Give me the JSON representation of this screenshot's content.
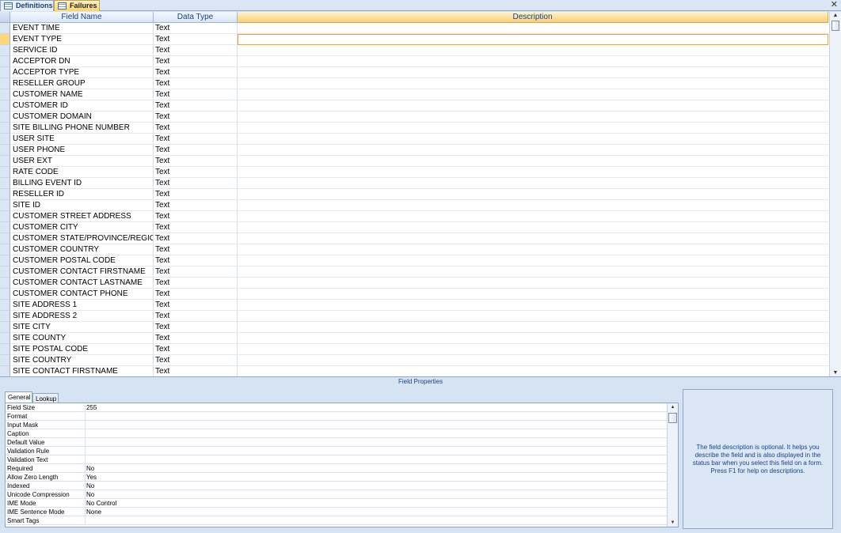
{
  "tabs": [
    {
      "label": "Definitions",
      "active": false
    },
    {
      "label": "Failures",
      "active": true
    }
  ],
  "close_glyph": "✕",
  "grid": {
    "columns": [
      "Field Name",
      "Data Type",
      "Description"
    ],
    "rows": [
      {
        "name": "EVENT TIME",
        "type": "Text"
      },
      {
        "name": "EVENT TYPE",
        "type": "Text"
      },
      {
        "name": "SERVICE ID",
        "type": "Text"
      },
      {
        "name": "ACCEPTOR DN",
        "type": "Text"
      },
      {
        "name": "ACCEPTOR TYPE",
        "type": "Text"
      },
      {
        "name": "RESELLER GROUP",
        "type": "Text"
      },
      {
        "name": "CUSTOMER NAME",
        "type": "Text"
      },
      {
        "name": "CUSTOMER ID",
        "type": "Text"
      },
      {
        "name": "CUSTOMER DOMAIN",
        "type": "Text"
      },
      {
        "name": "SITE BILLING PHONE NUMBER",
        "type": "Text"
      },
      {
        "name": "USER SITE",
        "type": "Text"
      },
      {
        "name": "USER PHONE",
        "type": "Text"
      },
      {
        "name": "USER EXT",
        "type": "Text"
      },
      {
        "name": "RATE CODE",
        "type": "Text"
      },
      {
        "name": "BILLING EVENT ID",
        "type": "Text"
      },
      {
        "name": "RESELLER ID",
        "type": "Text"
      },
      {
        "name": "SITE ID",
        "type": "Text"
      },
      {
        "name": "CUSTOMER STREET ADDRESS",
        "type": "Text"
      },
      {
        "name": "CUSTOMER CITY",
        "type": "Text"
      },
      {
        "name": "CUSTOMER STATE/PROVINCE/REGION",
        "type": "Text"
      },
      {
        "name": "CUSTOMER COUNTRY",
        "type": "Text"
      },
      {
        "name": "CUSTOMER POSTAL CODE",
        "type": "Text"
      },
      {
        "name": "CUSTOMER CONTACT FIRSTNAME",
        "type": "Text"
      },
      {
        "name": "CUSTOMER CONTACT LASTNAME",
        "type": "Text"
      },
      {
        "name": "CUSTOMER CONTACT PHONE",
        "type": "Text"
      },
      {
        "name": "SITE ADDRESS 1",
        "type": "Text"
      },
      {
        "name": "SITE ADDRESS 2",
        "type": "Text"
      },
      {
        "name": "SITE CITY",
        "type": "Text"
      },
      {
        "name": "SITE COUNTY",
        "type": "Text"
      },
      {
        "name": "SITE POSTAL CODE",
        "type": "Text"
      },
      {
        "name": "SITE COUNTRY",
        "type": "Text"
      },
      {
        "name": "SITE CONTACT FIRSTNAME",
        "type": "Text"
      }
    ],
    "current_row": 1
  },
  "field_properties": {
    "title": "Field Properties",
    "tabs": [
      "General",
      "Lookup"
    ],
    "active_tab": "General",
    "rows": [
      {
        "label": "Field Size",
        "value": "255"
      },
      {
        "label": "Format",
        "value": ""
      },
      {
        "label": "Input Mask",
        "value": ""
      },
      {
        "label": "Caption",
        "value": ""
      },
      {
        "label": "Default Value",
        "value": ""
      },
      {
        "label": "Validation Rule",
        "value": ""
      },
      {
        "label": "Validation Text",
        "value": ""
      },
      {
        "label": "Required",
        "value": "No"
      },
      {
        "label": "Allow Zero Length",
        "value": "Yes"
      },
      {
        "label": "Indexed",
        "value": "No"
      },
      {
        "label": "Unicode Compression",
        "value": "No"
      },
      {
        "label": "IME Mode",
        "value": "No Control"
      },
      {
        "label": "IME Sentence Mode",
        "value": "None"
      },
      {
        "label": "Smart Tags",
        "value": ""
      }
    ],
    "help_text": "The field description is optional.  It helps you describe the field and is also displayed in the status bar when you select this field on a form.  Press F1 for help on descriptions."
  },
  "icons": {
    "table_tab": "table-icon",
    "scroll_up": "▲",
    "scroll_down": "▼"
  },
  "colors": {
    "active_tab": "#ffd36b",
    "header_text": "#15428b",
    "selection_border": "#f0a030",
    "panel_bg": "#d6e3f2"
  }
}
